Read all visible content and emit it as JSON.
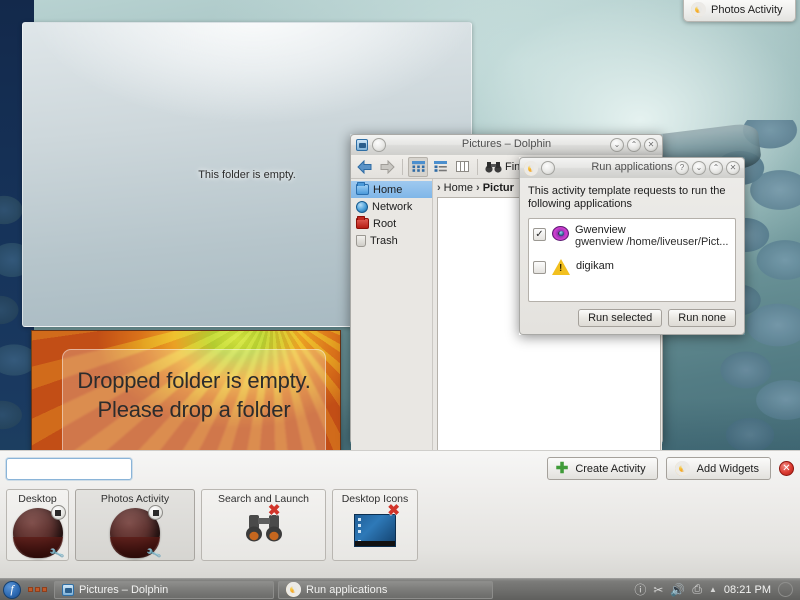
{
  "desktop": {
    "folderview": {
      "empty_message": "This folder is empty."
    },
    "dropwidget": {
      "message": "Dropped folder is empty. Please drop a folder"
    },
    "activity_pill": {
      "label": "Photos Activity",
      "icon": "plasma-icon"
    }
  },
  "dolphin": {
    "title": "Pictures – Dolphin",
    "window_icon": "dolphin-icon",
    "titlebar_buttons": [
      "menu-button",
      "shade-button",
      "maximize-button",
      "close-button"
    ],
    "toolbar": {
      "back": "back-arrow-icon",
      "forward": "forward-arrow-icon",
      "view_icons": "icons-view-icon",
      "view_details": "details-view-icon",
      "view_columns": "columns-view-icon",
      "find_label": "Fin"
    },
    "places": [
      {
        "label": "Home",
        "icon": "home-folder-icon",
        "selected": true
      },
      {
        "label": "Network",
        "icon": "network-globe-icon",
        "selected": false
      },
      {
        "label": "Root",
        "icon": "root-folder-icon",
        "selected": false
      },
      {
        "label": "Trash",
        "icon": "trash-icon",
        "selected": false
      }
    ],
    "breadcrumb": {
      "sep1": "›",
      "home": "Home",
      "sep2": "›",
      "current": "Pictur"
    }
  },
  "run_dialog": {
    "title": "Run applications",
    "window_icon": "plasma-icon",
    "titlebar_buttons": [
      "help-button",
      "shade-button",
      "maximize-button",
      "close-button"
    ],
    "message": "This activity template requests to run the following applications",
    "apps": [
      {
        "name": "Gwenview",
        "command": "gwenview /home/liveuser/Pict...",
        "icon": "gwenview-eye-icon",
        "checked": true,
        "check_glyph": "✓"
      },
      {
        "name": "digikam",
        "command": "",
        "icon": "warning-triangle-icon",
        "checked": false,
        "check_glyph": ""
      }
    ],
    "buttons": {
      "run_selected": "Run selected",
      "run_none": "Run none"
    }
  },
  "activity_panel": {
    "search": {
      "value": "",
      "placeholder": ""
    },
    "create_activity": "Create Activity",
    "add_widgets": "Add Widgets",
    "close_glyph": "✕",
    "activities": [
      {
        "label": "Desktop",
        "kind": "activity",
        "selected": false,
        "badge": "stop-badge",
        "overlay": "wrench-icon"
      },
      {
        "label": "Photos Activity",
        "kind": "activity",
        "selected": true,
        "badge": "stop-badge",
        "overlay": "wrench-icon"
      },
      {
        "label": "Search and Launch",
        "kind": "template",
        "icon": "binoculars-icon",
        "remove": "✖"
      },
      {
        "label": "Desktop Icons",
        "kind": "template",
        "icon": "desktop-icons-icon",
        "remove": "✖"
      }
    ]
  },
  "taskbar": {
    "kmenu_glyph": "f",
    "tasks": [
      {
        "label": "Pictures – Dolphin",
        "icon": "dolphin-icon"
      },
      {
        "label": "Run applications",
        "icon": "plasma-icon"
      }
    ],
    "tray": {
      "info_glyph": "ⓘ",
      "scissors_glyph": "✂",
      "volume_glyph": "🔊",
      "printer_glyph": "⎙",
      "arrow_glyph": "▲",
      "clock": "08:21 PM",
      "end_glyph": "◔"
    }
  },
  "colors": {
    "accent_blue": "#7fb6e8",
    "panel_bg": "#eeedeb",
    "taskbar_bg": "#6e6e6c",
    "close_red": "#dc3b31",
    "wallpaper_teal": "#7aa2a4"
  }
}
